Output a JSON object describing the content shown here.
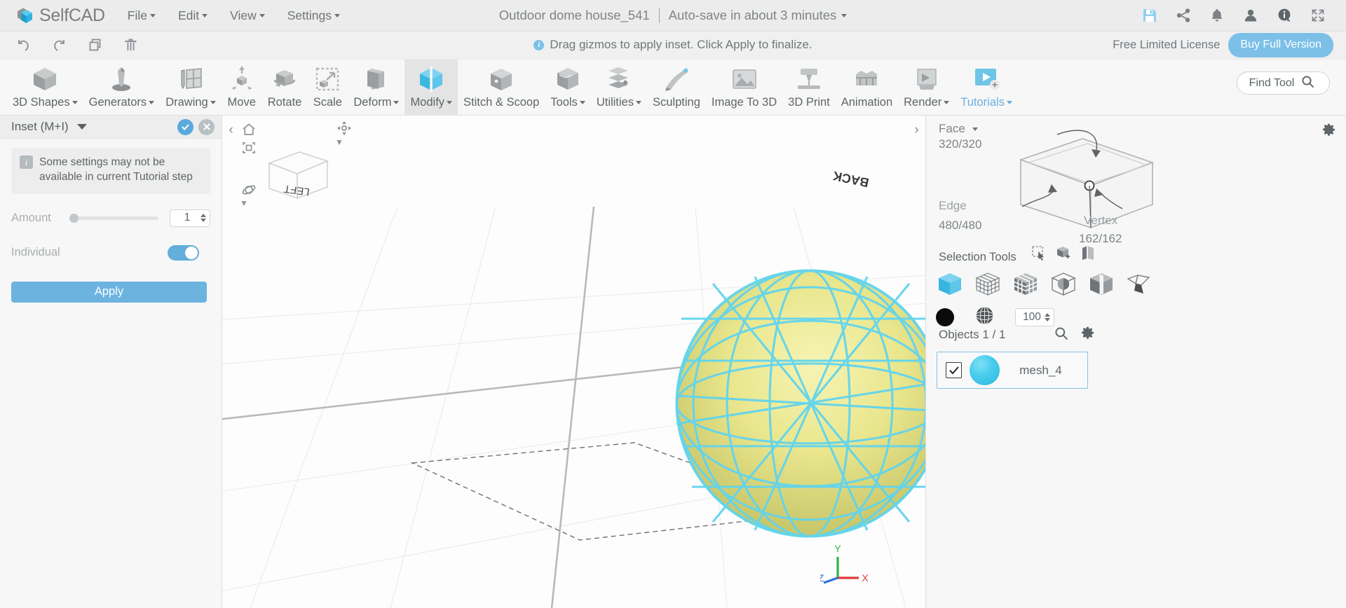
{
  "app": {
    "logo_text": "SelfCAD",
    "menus": [
      {
        "label": "File"
      },
      {
        "label": "Edit"
      },
      {
        "label": "View"
      },
      {
        "label": "Settings"
      }
    ],
    "document_title": "Outdoor dome house_541",
    "autosave_status": "Auto-save in about 3 minutes",
    "top_icons": [
      {
        "name": "save-icon"
      },
      {
        "name": "share-icon"
      },
      {
        "name": "notifications-bell-icon"
      },
      {
        "name": "user-account-icon"
      },
      {
        "name": "info-icon"
      },
      {
        "name": "fullscreen-icon"
      }
    ]
  },
  "secondbar": {
    "icons": [
      {
        "name": "undo-icon"
      },
      {
        "name": "redo-icon"
      },
      {
        "name": "copy-icon"
      },
      {
        "name": "delete-icon"
      }
    ],
    "hint": "Drag gizmos to apply inset. Click Apply to finalize.",
    "license_text": "Free Limited License",
    "buy_label": "Buy Full Version"
  },
  "toolbar": {
    "tools": [
      {
        "label": "3D Shapes",
        "icon": "cube-icon",
        "caret": true,
        "active": false
      },
      {
        "label": "Generators",
        "icon": "generators-icon",
        "caret": true,
        "active": false
      },
      {
        "label": "Drawing",
        "icon": "drawing-pencil-icon",
        "caret": true,
        "active": false
      },
      {
        "label": "Move",
        "icon": "move-arrows-icon",
        "caret": false,
        "active": false
      },
      {
        "label": "Rotate",
        "icon": "rotate-icon",
        "caret": false,
        "active": false
      },
      {
        "label": "Scale",
        "icon": "scale-icon",
        "caret": false,
        "active": false
      },
      {
        "label": "Deform",
        "icon": "deform-icon",
        "caret": true,
        "active": false
      },
      {
        "label": "Modify",
        "icon": "modify-icon",
        "caret": true,
        "active": true
      },
      {
        "label": "Stitch & Scoop",
        "icon": "stitch-scoop-icon",
        "caret": false,
        "active": false
      },
      {
        "label": "Tools",
        "icon": "tools-icon",
        "caret": true,
        "active": false
      },
      {
        "label": "Utilities",
        "icon": "utilities-icon",
        "caret": true,
        "active": false
      },
      {
        "label": "Sculpting",
        "icon": "sculpting-brush-icon",
        "caret": false,
        "active": false
      },
      {
        "label": "Image To 3D",
        "icon": "image-to-3d-icon",
        "caret": false,
        "active": false
      },
      {
        "label": "3D Print",
        "icon": "3d-print-icon",
        "caret": false,
        "active": false
      },
      {
        "label": "Animation",
        "icon": "animation-icon",
        "caret": false,
        "active": false
      },
      {
        "label": "Render",
        "icon": "render-icon",
        "caret": true,
        "active": false
      },
      {
        "label": "Tutorials",
        "icon": "tutorials-icon",
        "caret": true,
        "active": false
      }
    ],
    "find_tool_label": "Find Tool"
  },
  "left_panel": {
    "title": "Inset (M+I)",
    "confirm_icon": "check-icon",
    "cancel_icon": "close-icon",
    "notice": "Some settings may not be available in current Tutorial step",
    "amount_label": "Amount",
    "amount_value": "1",
    "individual_label": "Individual",
    "individual_on": true,
    "apply_label": "Apply"
  },
  "viewport": {
    "nav_icons": [
      {
        "name": "home-icon"
      },
      {
        "name": "screenshot-icon"
      },
      {
        "name": "axis-lock-icon"
      },
      {
        "name": "orbit-icon"
      }
    ],
    "collapse_left_icon": "chevron-left-icon",
    "collapse_right_icon": "chevron-right-icon",
    "cube_labels": {
      "left": "LEFT",
      "back": "BACK"
    },
    "axis_labels": {
      "x": "X",
      "y": "Y",
      "z": "Z"
    }
  },
  "right_panel": {
    "mode_label": "Face",
    "face_count": "320/320",
    "edge_label": "Edge",
    "edge_count": "480/480",
    "vertex_label": "Vertex",
    "vertex_count": "162/162",
    "selection_tools_label": "Selection Tools",
    "selection_small_icons": [
      {
        "name": "rect-select-icon"
      },
      {
        "name": "add-select-icon"
      },
      {
        "name": "invert-select-icon"
      }
    ],
    "selection_modes": [
      {
        "name": "select-object-icon",
        "active": true
      },
      {
        "name": "select-wireframe-icon",
        "active": false
      },
      {
        "name": "select-blocks-icon",
        "active": false
      },
      {
        "name": "select-inner-icon",
        "active": false
      },
      {
        "name": "select-half-icon",
        "active": false
      },
      {
        "name": "select-polygon-icon",
        "active": false
      }
    ],
    "swatch_color": "#0b0b0b",
    "texture_icon": "mesh-texture-icon",
    "opacity_value": "100",
    "objects_header": "Objects 1 / 1",
    "objects_search_icon": "search-icon",
    "objects_gear_icon": "gear-icon",
    "objects": [
      {
        "name": "mesh_4",
        "checked": true,
        "color": "#49cdee"
      }
    ]
  },
  "colors": {
    "accent": "#6cb3e0",
    "accent_active": "#5aa9dd",
    "model_fill": "#e6e487",
    "model_wire": "#5ed4f0"
  }
}
